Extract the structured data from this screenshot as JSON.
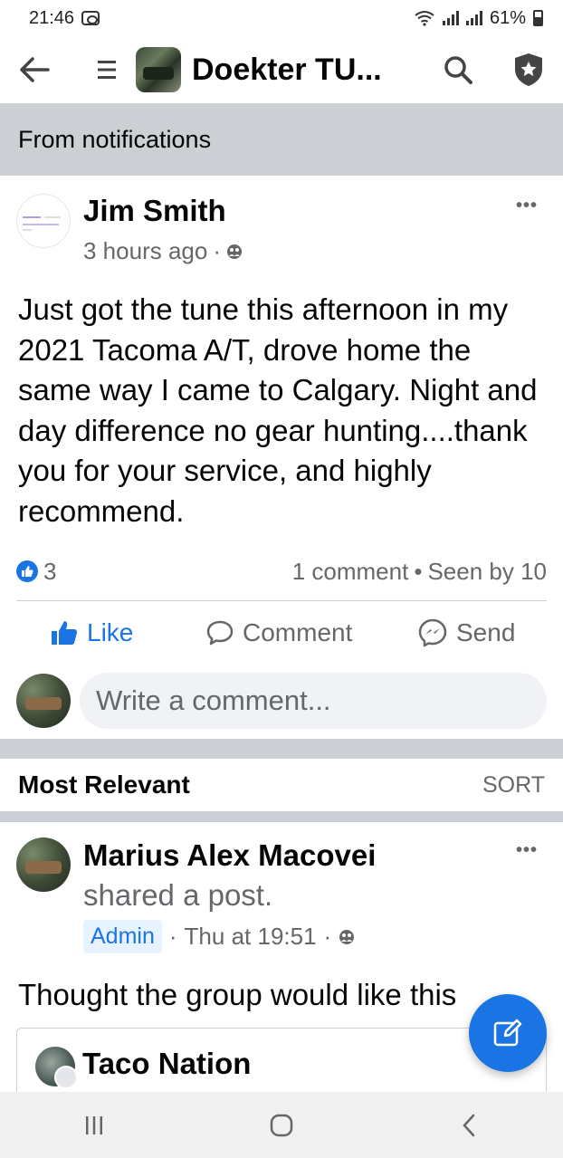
{
  "status_bar": {
    "time": "21:46",
    "battery": "61%",
    "icons": [
      "toyota-icon",
      "wifi-icon",
      "signal-icon",
      "signal-icon",
      "battery-icon"
    ]
  },
  "app_bar": {
    "group_title": "Doekter TU...",
    "icons": [
      "back-arrow-icon",
      "menu-icon",
      "search-icon",
      "shield-star-icon"
    ]
  },
  "banner": {
    "label": "From notifications"
  },
  "post": {
    "author": "Jim Smith",
    "time": "3 hours ago",
    "separator": "·",
    "body": "Just got the tune this afternoon in my 2021 Tacoma A/T, drove home the same way I came to Calgary. Night and day difference no gear hunting....thank you for your service, and highly recommend.",
    "reactions": {
      "count": "3",
      "comments": "1 comment",
      "dot": "•",
      "seen": "Seen by 10"
    },
    "actions": {
      "like": "Like",
      "comment": "Comment",
      "send": "Send"
    },
    "comment_placeholder": "Write a comment..."
  },
  "comments_section": {
    "title": "Most Relevant",
    "sort": "SORT"
  },
  "comment": {
    "author": "Marius Alex Macovei",
    "action": "shared a post.",
    "badge": "Admin",
    "time": "Thu at 19:51",
    "separator": "·",
    "text": "Thought the group would like this",
    "shared": {
      "title": "Taco Nation"
    }
  },
  "colors": {
    "accent": "#1b74e4",
    "banner": "#ccd0d5",
    "muted": "#65676b"
  }
}
